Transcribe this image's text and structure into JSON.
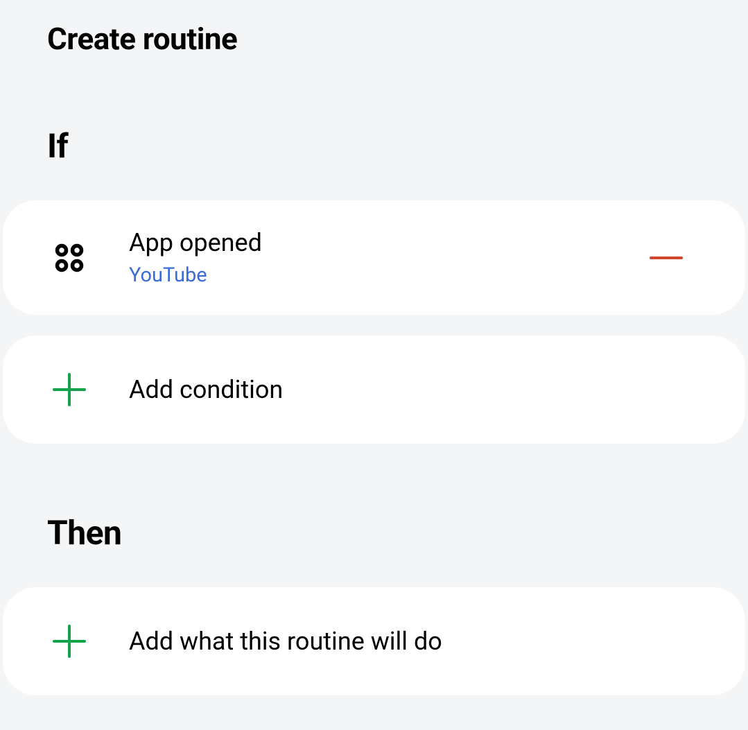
{
  "page": {
    "title": "Create routine"
  },
  "sections": {
    "if": {
      "title": "If",
      "condition": {
        "label": "App opened",
        "app": "YouTube"
      },
      "add_label": "Add condition"
    },
    "then": {
      "title": "Then",
      "add_label": "Add what this routine will do"
    }
  },
  "colors": {
    "accent_green": "#14a34b",
    "accent_red": "#d0452e",
    "link_blue": "#3a6bd6"
  }
}
